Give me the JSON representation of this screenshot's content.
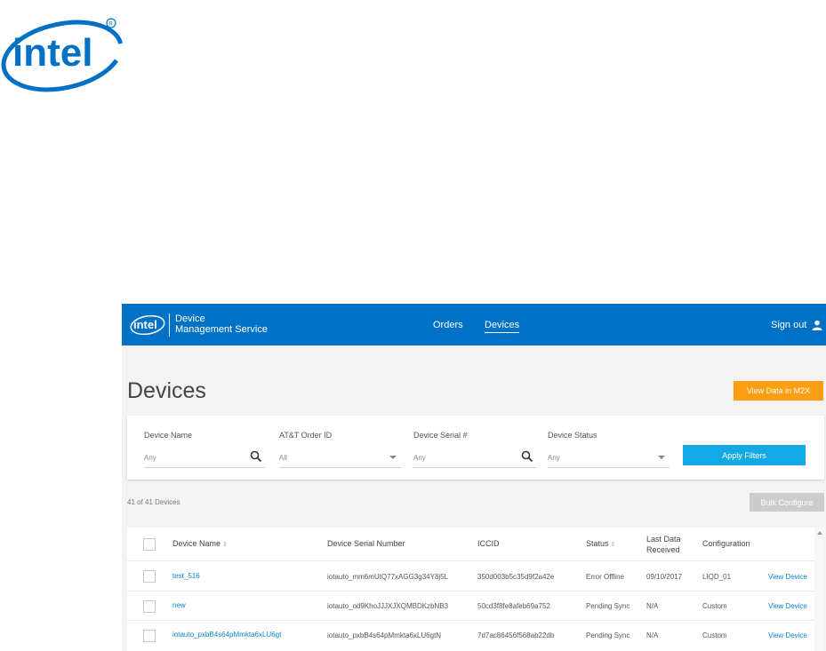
{
  "header": {
    "brand": "intel",
    "app_name": "Device\nManagement Service",
    "nav": [
      {
        "label": "Orders",
        "active": false
      },
      {
        "label": "Devices",
        "active": true
      }
    ],
    "sign_out": "Sign out",
    "brand_color": "#0071c5"
  },
  "page": {
    "title": "Devices",
    "view_m2x_button": "View Data in M2X"
  },
  "filters": {
    "device_name": {
      "label": "Device Name",
      "placeholder": "Any"
    },
    "order_id": {
      "label": "AT&T Order ID",
      "value": "All"
    },
    "serial": {
      "label": "Device Serial #",
      "placeholder": "Any"
    },
    "status": {
      "label": "Device Status",
      "value": "Any"
    },
    "apply_button": "Apply Filters"
  },
  "summary": {
    "count_text": "41 of 41 Devices",
    "bulk_button": "Bulk Configure"
  },
  "table": {
    "headers": {
      "name": "Device Name",
      "serial": "Device Serial Number",
      "iccid": "ICCID",
      "status": "Status",
      "last_data": "Last Data\nReceived",
      "config": "Configuration"
    },
    "rows": [
      {
        "name": "test_516",
        "serial": "iotauto_mm6mUtQ77xAGG3g34Y8j5L",
        "iccid": "350d003b5c35d9f2a42e",
        "status": "Error Offline",
        "last": "09/10/2017",
        "config": "LIQD_01",
        "action": "View Device"
      },
      {
        "name": "new",
        "serial": "iotauto_od9KhoJJJXJXQMBDKzbNB3",
        "iccid": "50cd3f8fe8afeb69a752",
        "status": "Pending Sync",
        "last": "N/A",
        "config": "Custom",
        "action": "View Device"
      },
      {
        "name": "iotauto_pxbB4s64pMmkta6xLU6gt",
        "serial": "iotauto_pxbB4s64pMmkta6xLU6gtN",
        "iccid": "7d7ac86456f568ab22db",
        "status": "Pending Sync",
        "last": "N/A",
        "config": "Custom",
        "action": "View Device"
      }
    ]
  },
  "colors": {
    "accent_orange": "#fc9d12",
    "accent_blue": "#12a9e6",
    "link_blue": "#0a84cc"
  }
}
